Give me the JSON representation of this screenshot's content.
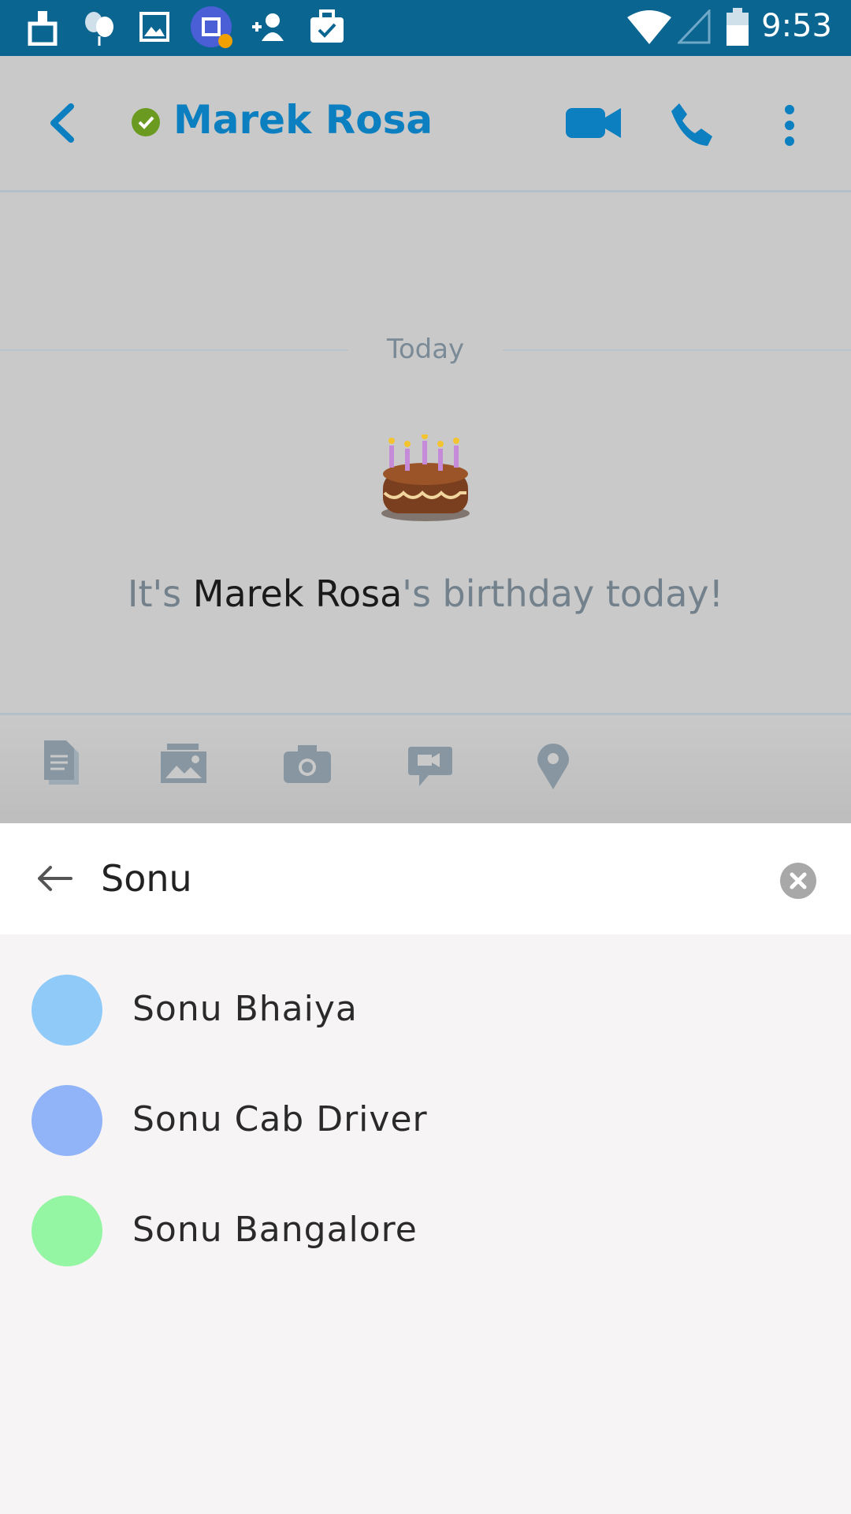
{
  "status_bar": {
    "time": "9:53",
    "icons": [
      "cleaner-icon",
      "balloons-icon",
      "image-icon",
      "app-alert-icon",
      "add-contact-icon",
      "briefcase-check-icon",
      "wifi-icon",
      "signal-icon",
      "battery-icon"
    ]
  },
  "chat_header": {
    "contact_name": "Marek Rosa",
    "presence_color": "#6a9a1f",
    "accent_color": "#0b7fbf"
  },
  "conversation": {
    "date_divider": "Today",
    "birthday_prefix": "It's ",
    "birthday_name": "Marek Rosa",
    "birthday_suffix": "'s birthday today!"
  },
  "attachment_bar": {
    "icons": [
      "document-icon",
      "photo-gallery-icon",
      "camera-icon",
      "video-message-icon",
      "location-icon"
    ]
  },
  "search": {
    "value": "Sonu"
  },
  "results": [
    {
      "name": "Sonu Bhaiya",
      "color": "#90caf9"
    },
    {
      "name": "Sonu Cab Driver",
      "color": "#90b4f7"
    },
    {
      "name": "Sonu Bangalore",
      "color": "#94f5a2"
    }
  ]
}
